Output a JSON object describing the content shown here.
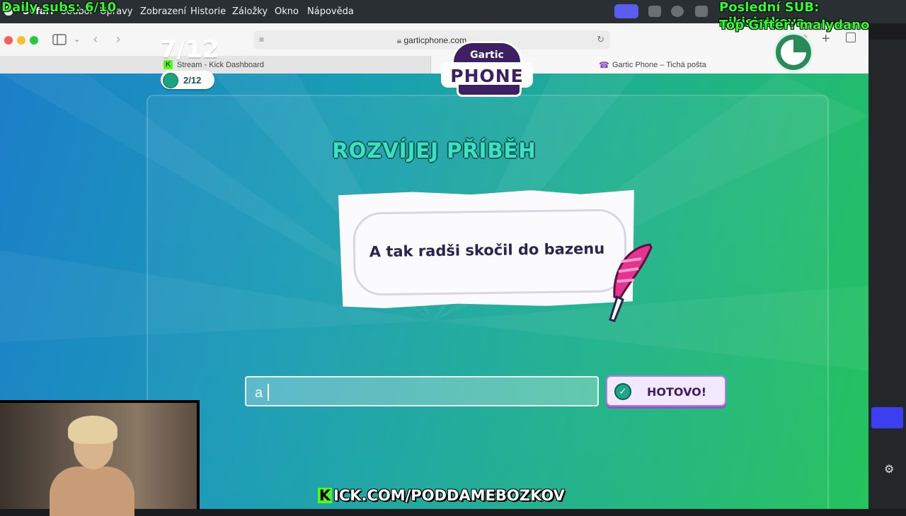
{
  "menubar": {
    "app": "Safari",
    "items": [
      "Soubor",
      "Úpravy",
      "Zobrazení",
      "Historie",
      "Záložky",
      "Okno",
      "Nápověda"
    ]
  },
  "browser": {
    "url": "garticphone.com",
    "tabs": [
      {
        "label": "Stream - Kick Dashboard"
      },
      {
        "label": "Gartic Phone – Tichá pošta"
      }
    ]
  },
  "game": {
    "round": "7/12",
    "players_done": "2/12",
    "logo_top": "Gartic",
    "logo_main": "PHONE",
    "heading": "ROZVÍJEJ PŘÍBĚH",
    "prompt": "A tak radši skočil do bazenu",
    "input_value": "a",
    "done_label": "HOTOVO!"
  },
  "overlays": {
    "daily_subs": "Daily subs: 6/10",
    "last_sub": "Poslední SUB: nikisistkova",
    "top_gifter": "Top Gifter: malydano",
    "kick_url": "ICK.COM/PODDAMEBOZKOV",
    "kick_k": "K"
  },
  "colors": {
    "accent_purple": "#3d1f63",
    "heading_teal": "#3de0c2",
    "overlay_green": "#2dff2d",
    "kick_green": "#53fc18"
  }
}
